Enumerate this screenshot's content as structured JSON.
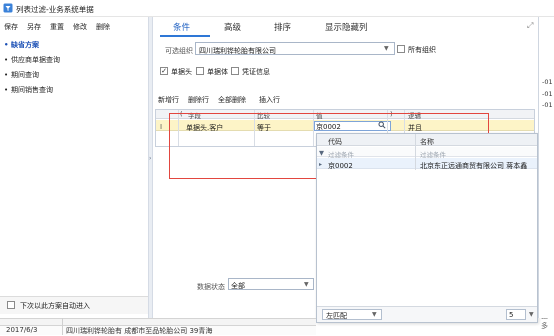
{
  "window": {
    "title": "列表过滤-业务系统单据"
  },
  "menu": {
    "items": [
      "保存",
      "另存",
      "重置",
      "修改",
      "删除"
    ]
  },
  "left_pane": {
    "items": [
      {
        "label": "缺省方案",
        "active": true
      },
      {
        "label": "供应商单据查询",
        "active": false
      },
      {
        "label": "期间查询",
        "active": false
      },
      {
        "label": "期间销售查询",
        "active": false
      }
    ],
    "auto_enter_label": "下次以此方案自动进入"
  },
  "tabs": [
    "条件",
    "高级",
    "排序",
    "显示隐藏列"
  ],
  "filter": {
    "org_label": "可选组织",
    "org_value": "四川瑞利铧轮胎有限公司",
    "all_org_label": "所有组织",
    "options": [
      {
        "label": "单据头",
        "checked": true
      },
      {
        "label": "单据体",
        "checked": false
      },
      {
        "label": "凭证信息",
        "checked": false
      }
    ]
  },
  "toolbar": {
    "items": [
      "新增行",
      "删除行",
      "全部删除",
      "插入行"
    ]
  },
  "grid": {
    "headers": [
      "(",
      "字段",
      "比较",
      "值",
      ")",
      "逻辑"
    ],
    "row": {
      "indicator": "I",
      "field": "单据头.客户",
      "compare": "等于",
      "value": "京0002",
      "logic": "并且"
    }
  },
  "popup": {
    "headers": [
      "代码",
      "名称"
    ],
    "filter_placeholder_code": "过滤条件",
    "filter_placeholder_name": "过滤条件",
    "row": {
      "code": "京0002",
      "name": "北京东正远通商贸有限公司 蒋本鑫"
    },
    "match_mode": "左匹配",
    "page_size": "5",
    "more_label": "更多"
  },
  "data_status": {
    "label": "数据状态",
    "value": "全部"
  },
  "background": {
    "date": "2017/6/3",
    "text": "四川瑞利铧轮胎有 成都市至品轮胎公司 39青海",
    "right_values": [
      "-01",
      "-01",
      "-01"
    ]
  },
  "colors": {
    "accent": "#2e77d6",
    "highlight": "#fdf4c7",
    "outline": "#e2463f"
  }
}
